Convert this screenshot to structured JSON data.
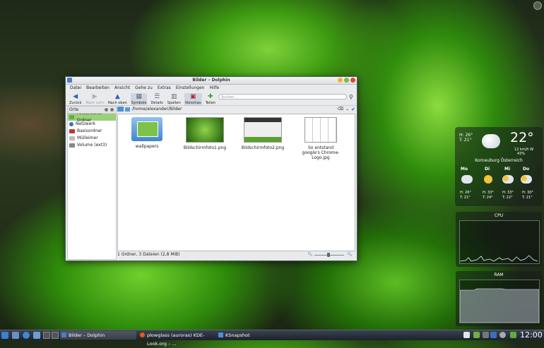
{
  "window": {
    "title": "Bilder – Dolphin",
    "menu": [
      "Datei",
      "Bearbeiten",
      "Ansicht",
      "Gehe zu",
      "Extras",
      "Einstellungen",
      "Hilfe"
    ],
    "toolbar": {
      "back": "Zurück",
      "forward": "Nach vorn",
      "up": "Nach oben",
      "icons": "Symbole",
      "details": "Details",
      "columns": "Spalten",
      "preview": "Vorschau",
      "share": "Teilen"
    },
    "search_placeholder": "Suchen ..."
  },
  "sidebar": {
    "header": "Orte",
    "items": [
      "Persönlicher Ordner",
      "Netzwerk",
      "Basisordner",
      "Mülleimer",
      "Volume (ext3)"
    ]
  },
  "location": "/home/alexander/Bilder",
  "files": [
    {
      "name": "wallpapers"
    },
    {
      "name": "Bildschirmfoto1.png"
    },
    {
      "name": "Bildschirmfoto2.png"
    },
    {
      "name": "So entstand google's Chrome-Logo.jpg"
    }
  ],
  "status": "1 Ordner, 3 Dateien (2,8 MiB)",
  "weather": {
    "high_low": "H: 26°\nT: 21°",
    "temp": "22°",
    "wind": "12 km/h W",
    "humidity": "43%",
    "location": "Korneuburg Österreich",
    "days": [
      {
        "day": "Mo",
        "hi": "H: 26°",
        "lo": "T: 21°"
      },
      {
        "day": "Di",
        "hi": "H: 33°",
        "lo": "T: 24°"
      },
      {
        "day": "Mi",
        "hi": "H: 33°",
        "lo": "T: 22°"
      },
      {
        "day": "Do",
        "hi": "H: 30°",
        "lo": "T: 21°"
      }
    ]
  },
  "cpu": {
    "label": "CPU"
  },
  "ram": {
    "label": "RAM"
  },
  "taskbar": {
    "tasks": [
      "Bilder – Dolphin",
      "plowglass (auroras) KDE-Look.org – ...",
      "KSnapshot"
    ],
    "clock": "12:00"
  }
}
